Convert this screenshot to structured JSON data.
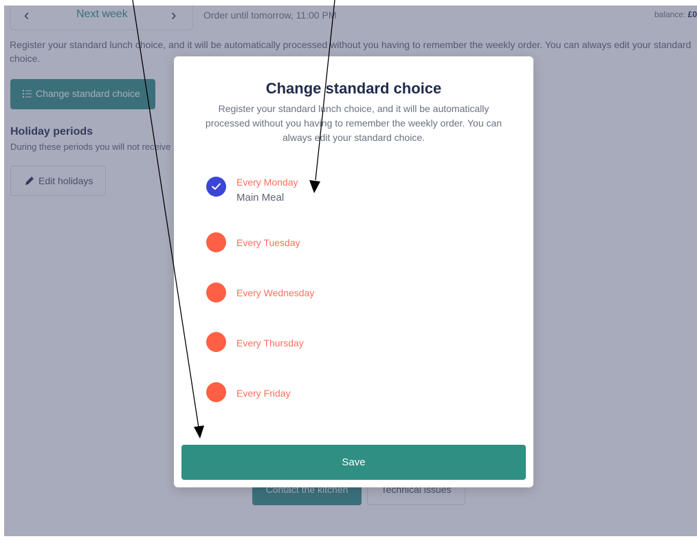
{
  "week_nav": {
    "prev_icon": "chevron-left-icon",
    "next_icon": "chevron-right-icon",
    "label": "Next week"
  },
  "order_until": "Order until tomorrow, 11:00 PM",
  "balance": {
    "label": "balance: ",
    "value": "£0"
  },
  "intro_text": "Register your standard lunch choice, and it will be automatically processed without you having to remember the weekly order. You can always edit your standard choice.",
  "change_standard_button": {
    "icon": "list-icon",
    "label": "Change standard choice"
  },
  "holidays": {
    "title": "Holiday periods",
    "text": "During these periods you will not receive",
    "edit_button": {
      "icon": "pencil-icon",
      "label": "Edit holidays"
    }
  },
  "footer_buttons": {
    "contact": "Contact the kitchen",
    "technical": "Technical issues"
  },
  "modal": {
    "title": "Change standard choice",
    "description": "Register your standard lunch choice, and it will be automatically processed without you having to remember the weekly order. You can always edit your standard choice.",
    "days": [
      {
        "label": "Every Monday",
        "meal": "Main Meal",
        "checked": true
      },
      {
        "label": "Every Tuesday",
        "meal": "",
        "checked": false
      },
      {
        "label": "Every Wednesday",
        "meal": "",
        "checked": false
      },
      {
        "label": "Every Thursday",
        "meal": "",
        "checked": false
      },
      {
        "label": "Every Friday",
        "meal": "",
        "checked": false
      }
    ],
    "save_label": "Save"
  },
  "colors": {
    "accent": "#2e8f82",
    "navy": "#1f2a4d",
    "checked": "#3d45d6",
    "unchecked": "#ff5f45",
    "day_label": "#ff6f5a"
  }
}
